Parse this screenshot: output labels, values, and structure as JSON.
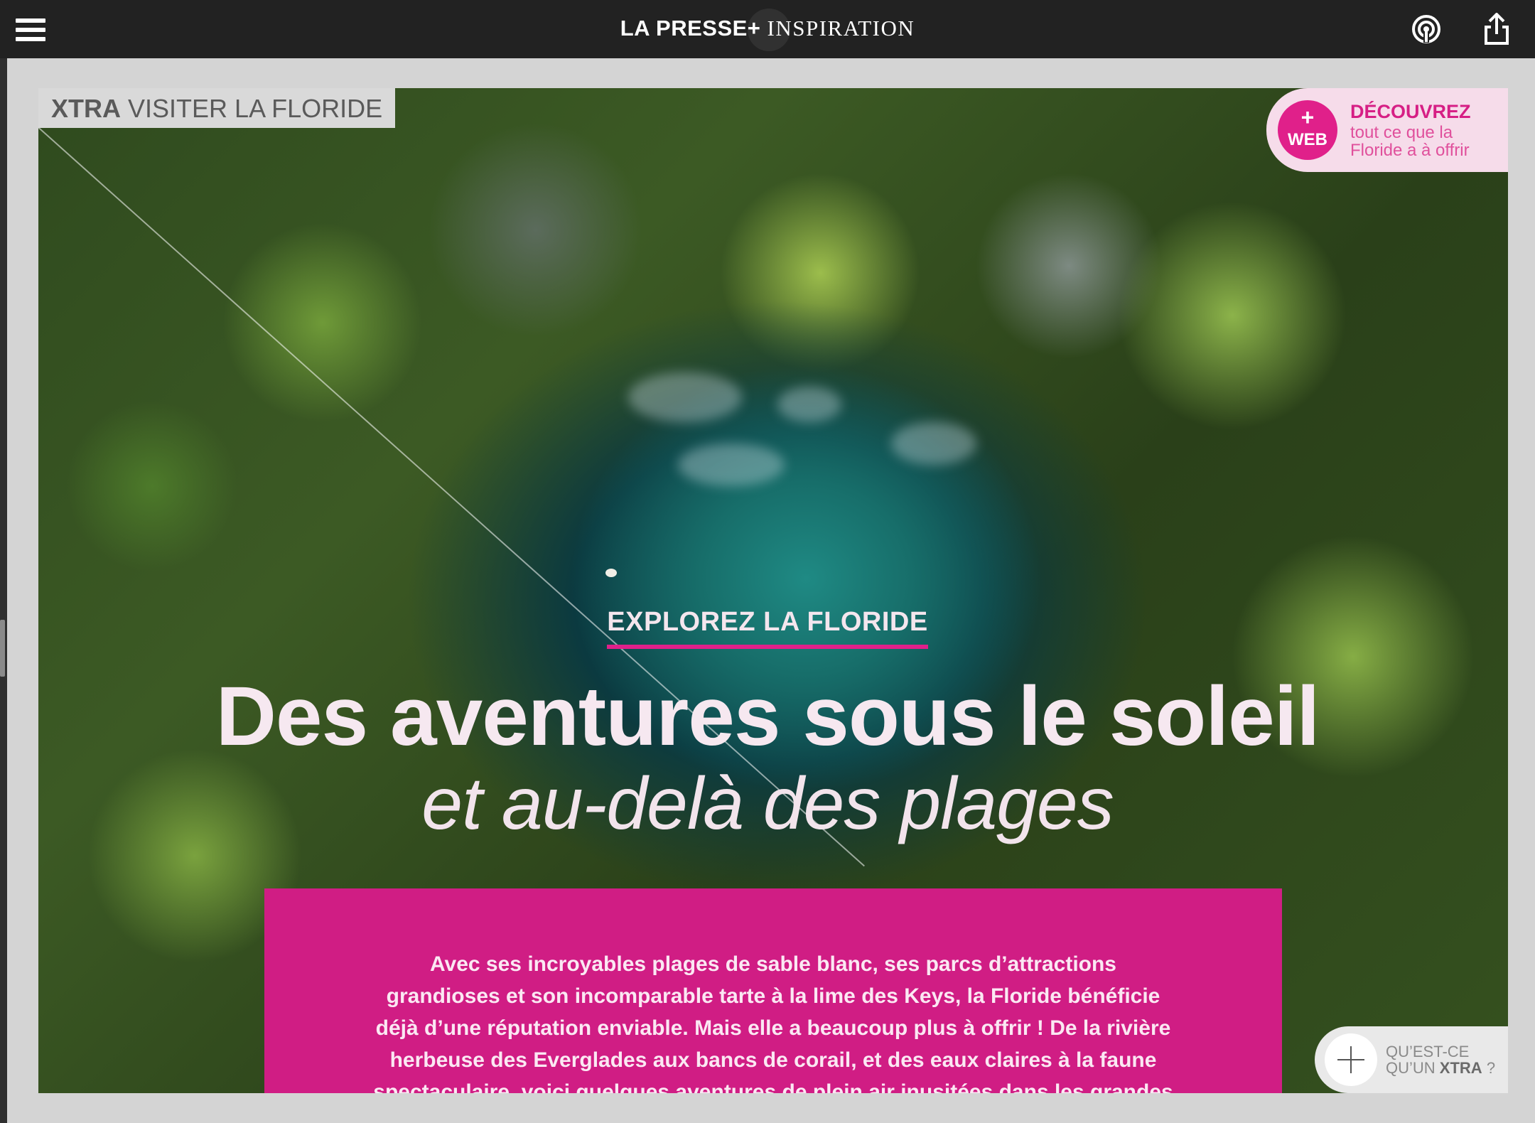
{
  "topbar": {
    "brand_bold": "LA PRESSE+",
    "brand_light": "INSPIRATION",
    "menu_icon": "hamburger-menu-icon",
    "podcast_icon": "podcast-icon",
    "share_icon": "share-icon"
  },
  "article": {
    "section_bold": "XTRA",
    "section_label": "VISITER LA FLORIDE",
    "kicker": "EXPLOREZ LA FLORIDE",
    "headline": "Des aventures sous le soleil",
    "subheadline": "et au-delà des plages",
    "intro": "Avec ses incroyables plages de sable blanc, ses parcs d’attractions grandioses et son incomparable tarte à la lime des Keys, la Floride bénéficie déjà d’une réputation enviable. Mais elle a beaucoup plus à offrir ! De la rivière herbeuse des Everglades aux bancs de corail, et des eaux claires à la faune spectaculaire, voici quelques aventures de plein air inusitées dans les grandes régions de l’État ensoleillé."
  },
  "web_promo": {
    "badge_plus": "+",
    "badge_label": "WEB",
    "title": "DÉCOUVREZ",
    "subtitle": "tout ce que la Floride a à offrir"
  },
  "xtra_help": {
    "line1": "QU’EST-CE",
    "line2_prefix": "QU’UN",
    "line2_bold": "XTRA",
    "line2_suffix": "?"
  },
  "colors": {
    "accent": "#e0208a",
    "intro_bg": "#d01d84",
    "topbar": "#222222"
  }
}
